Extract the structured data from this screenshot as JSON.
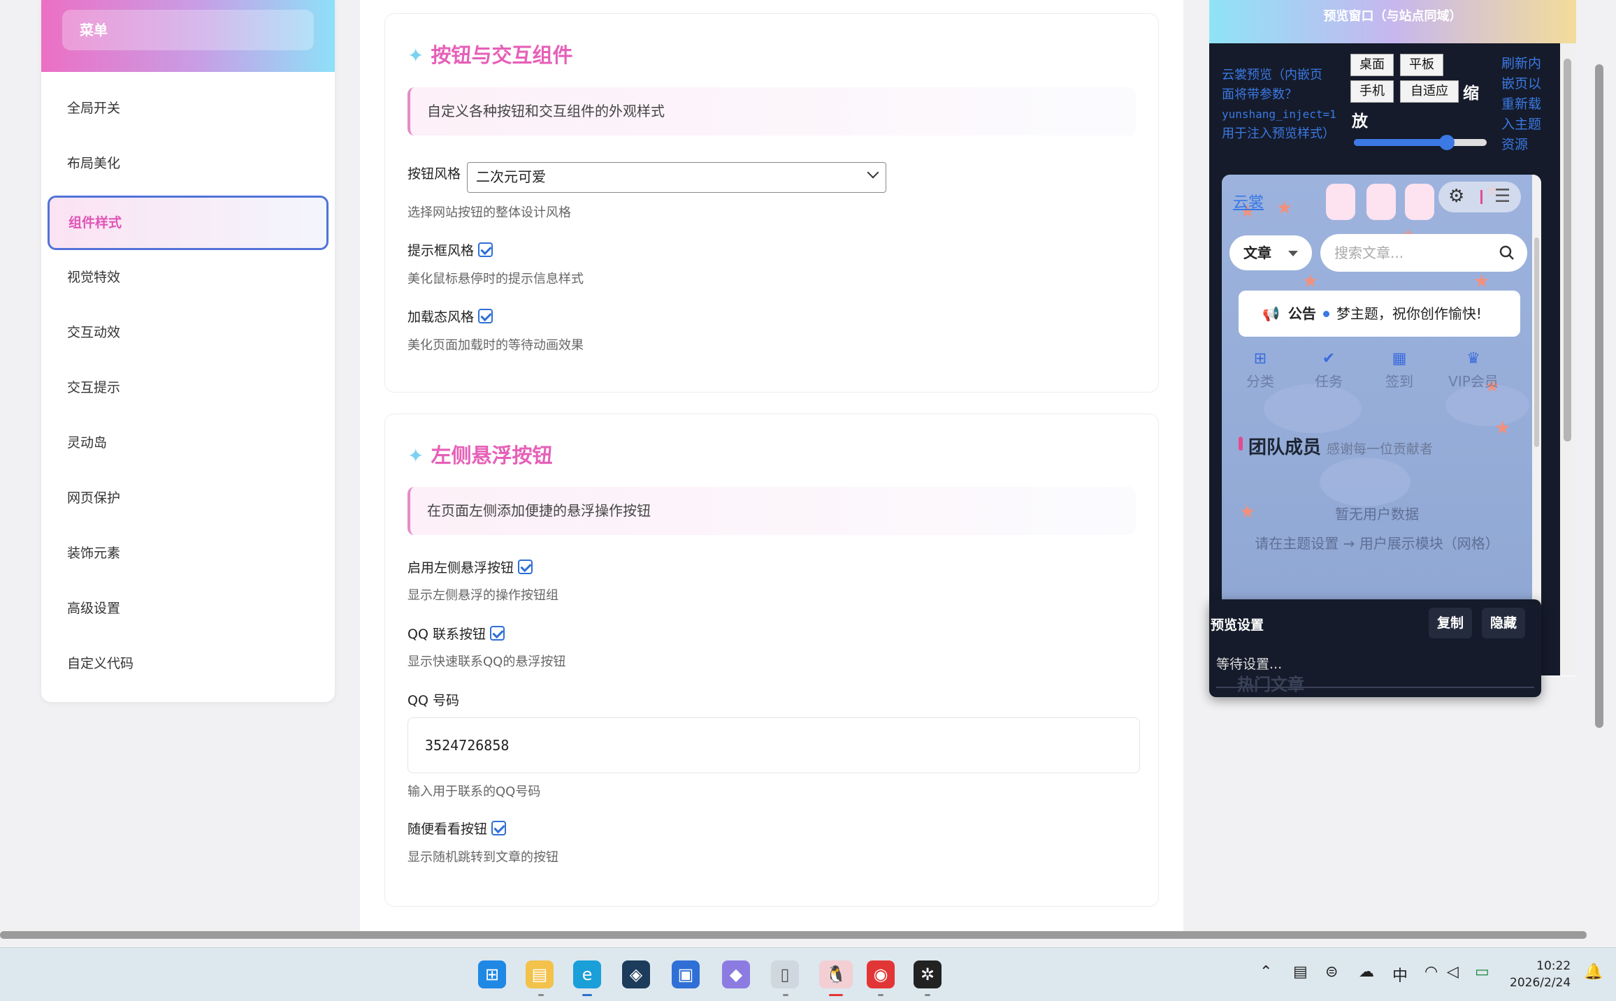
{
  "sidebar": {
    "header": "菜单",
    "items": [
      "全局开关",
      "布局美化",
      "组件样式",
      "视觉特效",
      "交互动效",
      "交互提示",
      "灵动岛",
      "网页保护",
      "装饰元素",
      "高级设置",
      "自定义代码"
    ],
    "active_index": 2
  },
  "section_buttons": {
    "title": "按钮与交互组件",
    "desc": "自定义各种按钮和交互组件的外观样式",
    "style_label": "按钮风格",
    "style_value": "二次元可爱",
    "style_hint": "选择网站按钮的整体设计风格",
    "tooltip_label": "提示框风格",
    "tooltip_hint": "美化鼠标悬停时的提示信息样式",
    "loading_label": "加载态风格",
    "loading_hint": "美化页面加载时的等待动画效果"
  },
  "section_float": {
    "title": "左侧悬浮按钮",
    "desc": "在页面左侧添加便捷的悬浮操作按钮",
    "enable_label": "启用左侧悬浮按钮",
    "enable_hint": "显示左侧悬浮的操作按钮组",
    "qq_btn_label": "QQ 联系按钮",
    "qq_btn_hint": "显示快速联系QQ的悬浮按钮",
    "qq_num_label": "QQ 号码",
    "qq_num_value": "3524726858",
    "qq_num_hint": "输入用于联系的QQ号码",
    "random_label": "随便看看按钮",
    "random_hint": "显示随机跳转到文章的按钮"
  },
  "preview": {
    "header": "预览窗口（与站点同域）",
    "info_line1": "云裳预览（内嵌页",
    "info_line2": "面将带参数？",
    "info_line3": "yunshang_inject=1",
    "info_line4": "用于注入预览样式）",
    "buttons": [
      "桌面",
      "平板",
      "手机",
      "自适应"
    ],
    "scale_char1": "缩",
    "scale_char2": "放",
    "slider_value": 0.7,
    "refresh_lines": [
      "刷新内",
      "嵌页以",
      "重新载",
      "入主题",
      "资源"
    ],
    "site": {
      "logo_alt": "云裳",
      "select_label": "文章",
      "search_placeholder": "搜索文章...",
      "notice_label": "公告",
      "notice_text": "梦主题，祝你创作愉快!",
      "nav": [
        "分类",
        "任务",
        "签到",
        "VIP会员"
      ],
      "team_title": "团队成员",
      "team_sub": "感谢每一位贡献者",
      "empty_line1": "暂无用户数据",
      "empty_line2": "请在主题设置 → 用户展示模块（网格）",
      "hot_title": "热门文章"
    },
    "panel": {
      "title": "预览设置",
      "copy": "复制",
      "hide": "隐藏",
      "status": "等待设置..."
    }
  },
  "taskbar": {
    "lang": "中",
    "time": "10:22",
    "date": "2026/2/24"
  }
}
